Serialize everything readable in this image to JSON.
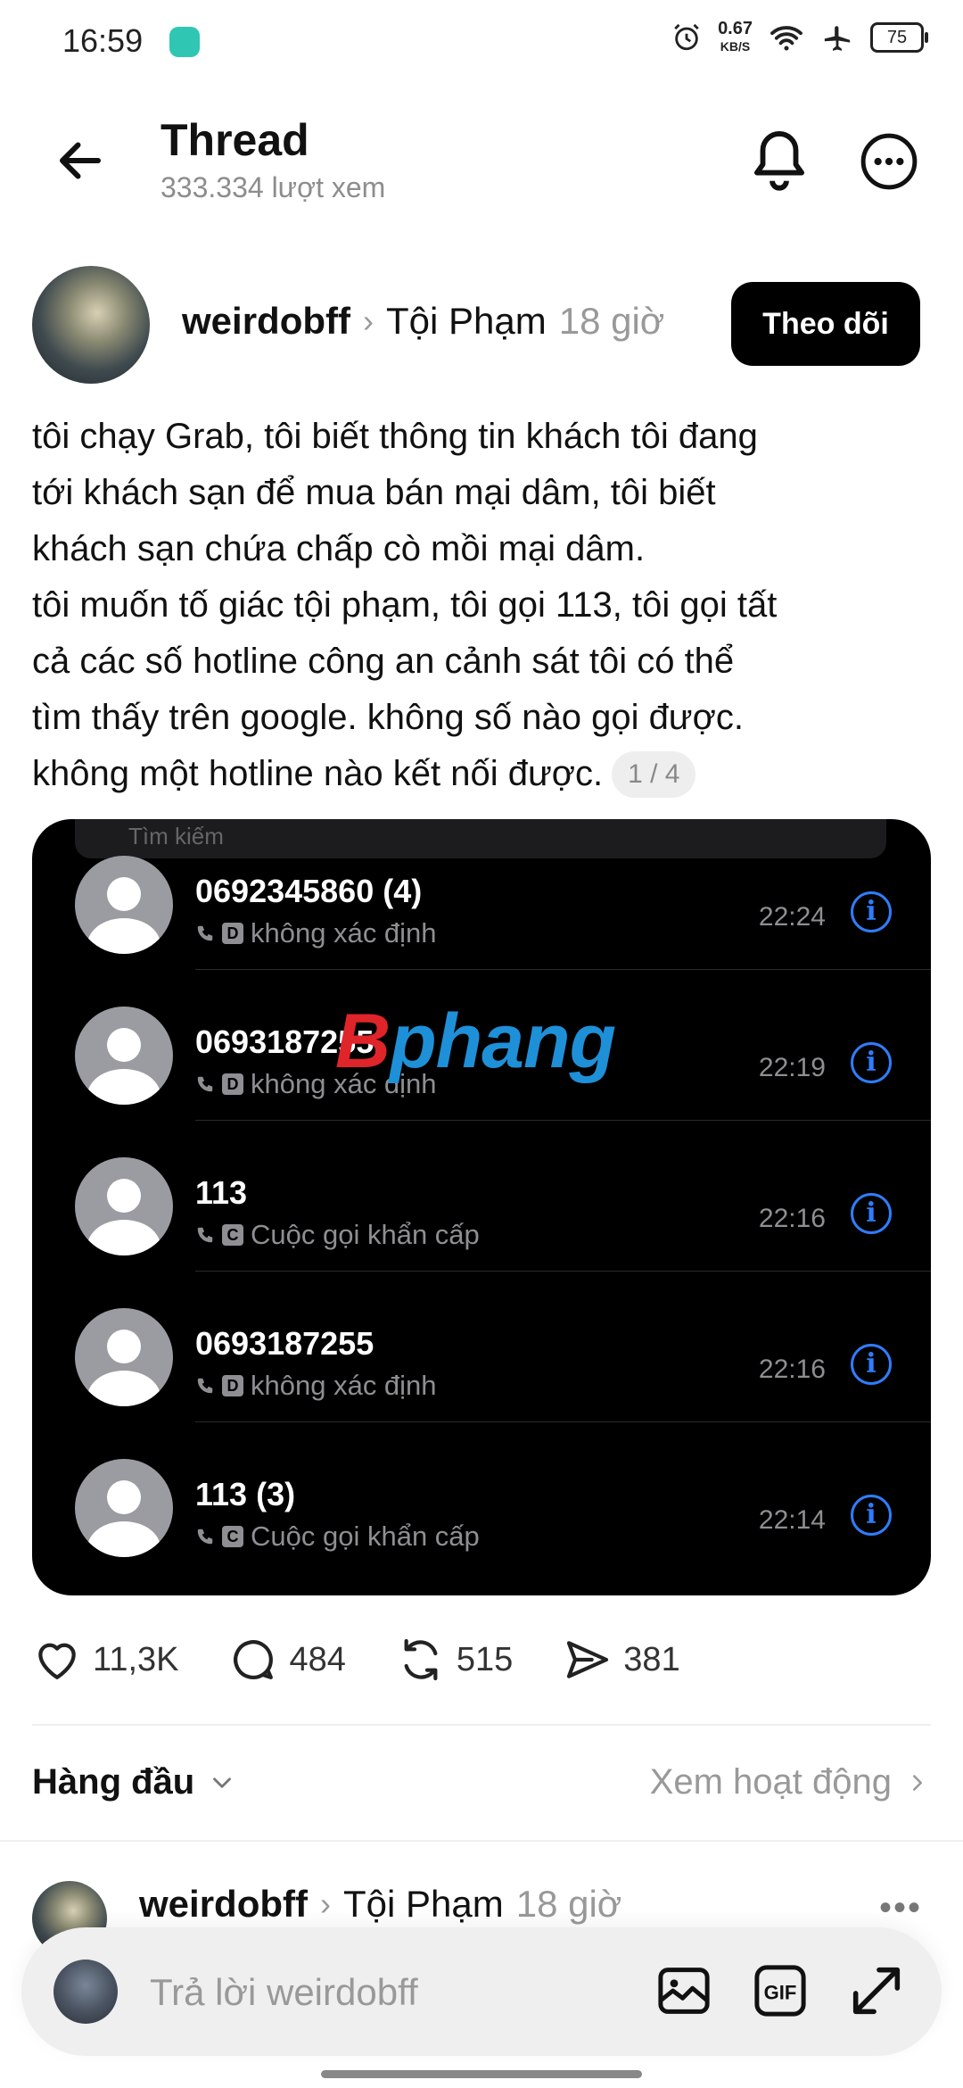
{
  "status_bar": {
    "time": "16:59",
    "net_speed_value": "0.67",
    "net_speed_unit": "KB/S",
    "battery": "75"
  },
  "header": {
    "title": "Thread",
    "views": "333.334 lượt xem"
  },
  "post": {
    "author": "weirdobff",
    "community": "Tội Phạm",
    "time": "18 giờ",
    "follow_label": "Theo dõi",
    "text": "tôi chạy Grab, tôi biết thông tin khách tôi đang\ntới khách sạn để mua bán mại dâm, tôi biết\nkhách sạn chứa chấp cò mồi mại dâm.\ntôi muốn tố giác tội phạm, tôi gọi 113, tôi gọi tất\ncả các số hotline công an cảnh sát tôi có thể\ntìm thấy trên google. không số nào gọi được.\nkhông một hotline nào kết nối được.",
    "page_indicator": "1 / 4",
    "image": {
      "search_placeholder": "Tìm kiếm",
      "watermark_p": "B",
      "watermark_rest": "phang",
      "calls": [
        {
          "number": "0692345860 (4)",
          "sim": "D",
          "label": "không xác định",
          "time": "22:24"
        },
        {
          "number": "0693187255",
          "sim": "D",
          "label": "không xác định",
          "time": "22:19"
        },
        {
          "number": "113",
          "sim": "C",
          "label": "Cuộc gọi khẩn cấp",
          "time": "22:16"
        },
        {
          "number": "0693187255",
          "sim": "D",
          "label": "không xác định",
          "time": "22:16"
        },
        {
          "number": "113 (3)",
          "sim": "C",
          "label": "Cuộc gọi khẩn cấp",
          "time": "22:14"
        }
      ]
    },
    "actions": {
      "likes": "11,3K",
      "comments": "484",
      "reposts": "515",
      "shares": "381"
    }
  },
  "sort": {
    "label": "Hàng đầu",
    "activity_label": "Xem hoạt động"
  },
  "reply_preview": {
    "author": "weirdobff",
    "community": "Tội Phạm",
    "time": "18 giờ"
  },
  "reply_bar": {
    "placeholder": "Trả lời weirdobff"
  }
}
